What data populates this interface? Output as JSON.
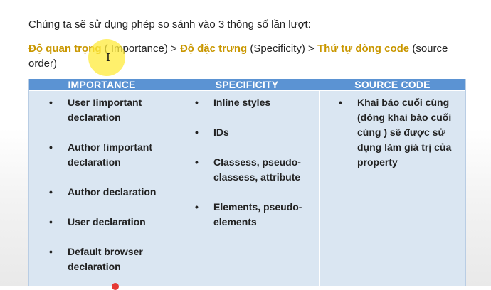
{
  "intro": "Chúng ta sẽ sử dụng phép so sánh vào 3 thông số lần lượt:",
  "order": {
    "kw1": "Độ quan trọng",
    "t1": " ( Importance) > ",
    "kw2": "Độ đặc trưng",
    "t2": " (Specificity) > ",
    "kw3": "Thứ tự dòng code",
    "t3": " (source order)"
  },
  "cursor_glyph": "I",
  "colors": {
    "keyword": "#c99700",
    "header_bg": "#5b93d3",
    "table_bg": "#dae6f2",
    "highlight": "#ffeb3b"
  },
  "table": {
    "headers": [
      "IMPORTANCE",
      "SPECIFICITY",
      "SOURCE CODE"
    ],
    "importance": [
      "User  !important declaration",
      "Author !important declaration",
      "Author declaration",
      "User declaration",
      "Default browser declaration"
    ],
    "specificity": [
      "Inline styles",
      "IDs",
      "Classess, pseudo-classess, attribute",
      "Elements, pseudo-elements"
    ],
    "source_code": [
      "Khai báo cuối cùng (dòng khai báo cuối cùng ) sẽ được sử dụng làm giá trị của property"
    ]
  }
}
